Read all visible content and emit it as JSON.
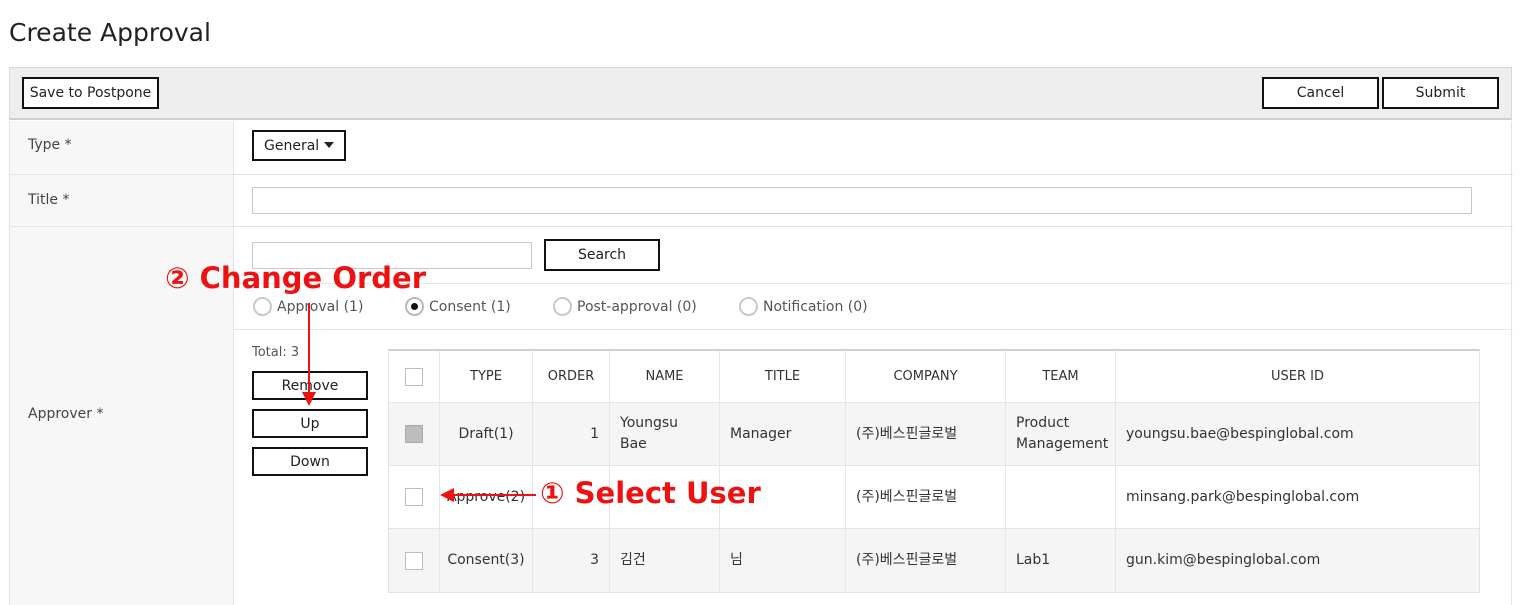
{
  "page": {
    "title": "Create Approval"
  },
  "toolbar": {
    "postpone_label": "Save to Postpone",
    "cancel_label": "Cancel",
    "submit_label": "Submit"
  },
  "fields": {
    "type_label": "Type *",
    "type_value": "General",
    "title_label": "Title *",
    "title_value": "",
    "approver_label": "Approver *"
  },
  "search": {
    "value": "",
    "button_label": "Search"
  },
  "approver_types": [
    {
      "label": "Approval (1)",
      "checked": false
    },
    {
      "label": "Consent (1)",
      "checked": true
    },
    {
      "label": "Post-approval (0)",
      "checked": false
    },
    {
      "label": "Notification (0)",
      "checked": false
    }
  ],
  "list": {
    "total": "Total: 3",
    "remove_label": "Remove",
    "up_label": "Up",
    "down_label": "Down"
  },
  "table": {
    "columns": [
      "TYPE",
      "ORDER",
      "NAME",
      "TITLE",
      "COMPANY",
      "TEAM",
      "USER ID"
    ],
    "rows": [
      {
        "type": "Draft(1)",
        "order": "1",
        "name": "Youngsu Bae",
        "title": "Manager",
        "company": "(주)베스핀글로벌",
        "team": "Product Management",
        "user_id": "youngsu.bae@bespinglobal.com",
        "checked": true
      },
      {
        "type": "Approve(2)",
        "order": "",
        "name": "",
        "title": "",
        "company": "(주)베스핀글로벌",
        "team": "",
        "user_id": "minsang.park@bespinglobal.com",
        "checked": false
      },
      {
        "type": "Consent(3)",
        "order": "3",
        "name": "김건",
        "title": "님",
        "company": "(주)베스핀글로벌",
        "team": "Lab1",
        "user_id": "gun.kim@bespinglobal.com",
        "checked": false
      }
    ]
  },
  "annotations": {
    "change_order": "② Change Order",
    "select_user": "① Select User",
    "color": "#ee1111"
  }
}
